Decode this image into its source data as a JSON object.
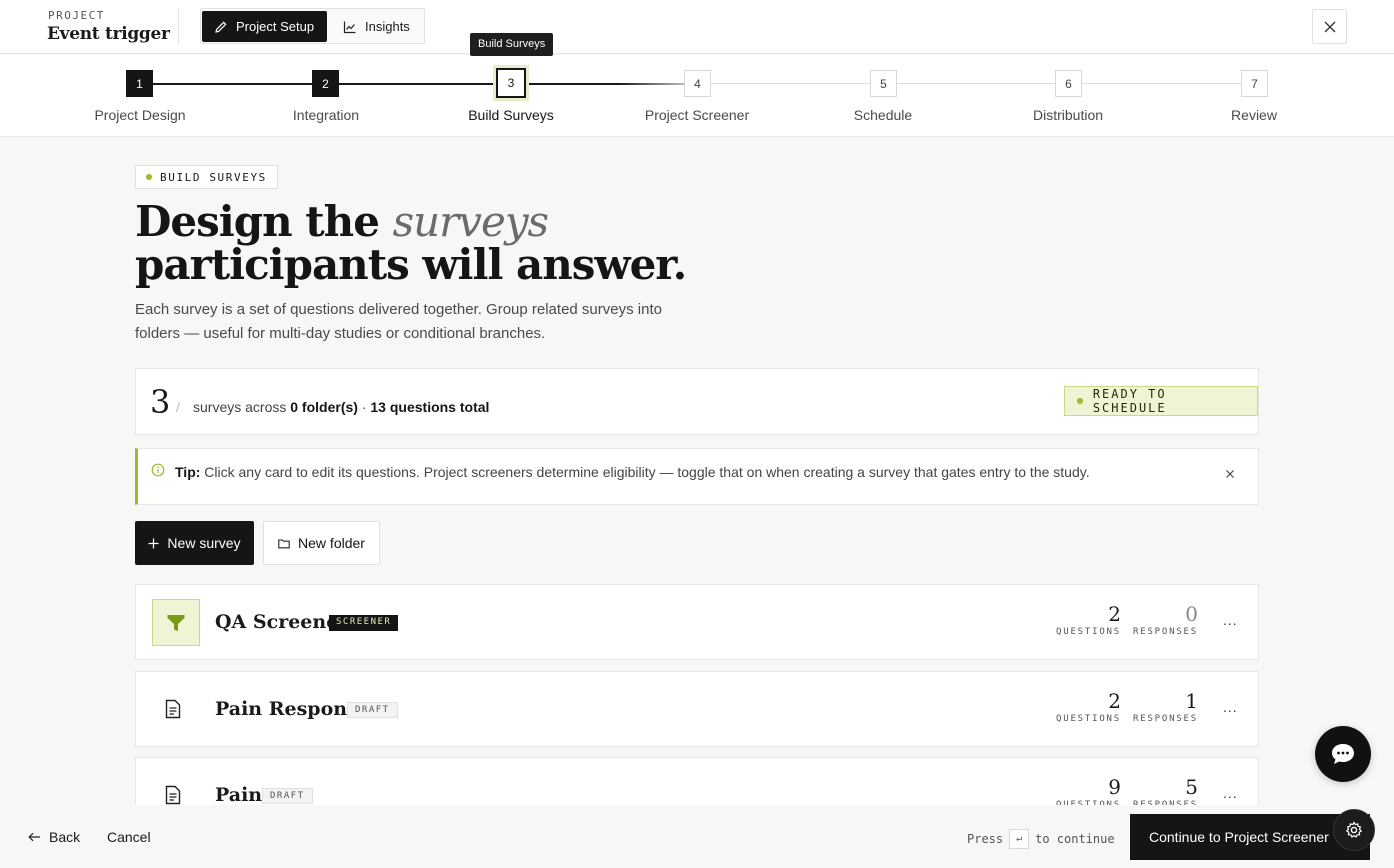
{
  "header": {
    "kicker": "PROJECT",
    "project_name": "Event trigger",
    "tabs": [
      {
        "label": "Project Setup",
        "icon": "pencil-icon"
      },
      {
        "label": "Insights",
        "icon": "chart-line-icon"
      }
    ],
    "close_icon": "close-icon"
  },
  "tooltip": "Build Surveys",
  "steps": [
    {
      "num": "1",
      "label": "Project Design",
      "state": "done"
    },
    {
      "num": "2",
      "label": "Integration",
      "state": "done"
    },
    {
      "num": "3",
      "label": "Build Surveys",
      "state": "current"
    },
    {
      "num": "4",
      "label": "Project Screener",
      "state": "todo"
    },
    {
      "num": "5",
      "label": "Schedule",
      "state": "todo"
    },
    {
      "num": "6",
      "label": "Distribution",
      "state": "todo"
    },
    {
      "num": "7",
      "label": "Review",
      "state": "todo"
    }
  ],
  "main": {
    "badge": "BUILD SURVEYS",
    "headline_pre": "Design the",
    "headline_em": "surveys",
    "headline_post": "participants will answer.",
    "lead": "Each survey is a set of questions delivered together. Group related surveys into folders — useful for multi-day studies or conditional branches.",
    "summary": {
      "count": "3",
      "slash": "/",
      "text_pre": "surveys across",
      "folders": "0 folder(s)",
      "sep": "·",
      "questions": "13 questions total",
      "status": "READY TO SCHEDULE"
    },
    "tip": {
      "label": "Tip:",
      "text": "Click any card to edit its questions. Project screeners determine eligibility — toggle that on when creating a survey that gates entry to the study."
    },
    "actions": {
      "new_survey": "New survey",
      "new_folder": "New folder"
    },
    "surveys": [
      {
        "title": "QA Screener",
        "tag": "SCREENER",
        "questions": "2",
        "responses": "0",
        "icon": "filter-icon"
      },
      {
        "title": "Pain Response",
        "tag": "DRAFT",
        "questions": "2",
        "responses": "1",
        "icon": "document-icon"
      },
      {
        "title": "Pain",
        "tag": "DRAFT",
        "questions": "9",
        "responses": "5",
        "icon": "document-icon"
      }
    ],
    "stat_labels": {
      "questions": "QUESTIONS",
      "responses": "RESPONSES"
    },
    "more": "..."
  },
  "footer": {
    "back": "Back",
    "cancel": "Cancel",
    "press": "Press",
    "key": "↵",
    "to_continue": "to continue",
    "continue": "Continue to Project Screener"
  },
  "colors": {
    "accent": "#9bbb2a",
    "accent_bg": "#eef5d5",
    "dark": "#151515"
  }
}
